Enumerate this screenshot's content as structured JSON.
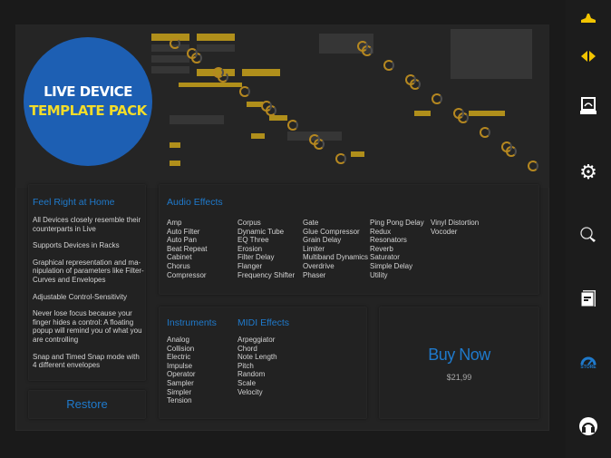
{
  "badge": {
    "line1": "LIVE DEVICE",
    "line2": "TEMPLATE PACK"
  },
  "features": {
    "title": "Feel Right at Home",
    "items": [
      "All Devices closely resemble their counterparts in Live",
      "Supports Devices in Racks",
      "Graphical representation and ma-nipulation of parameters like Filter-Curves and Envelopes",
      "Adjustable Control-Sensitivity",
      "Never lose focus because your finger hides a control: A floating popup will remind you of what you are controlling",
      "Snap and Timed Snap mode with 4 different envelopes"
    ]
  },
  "audio_effects": {
    "title": "Audio Effects",
    "columns": [
      [
        "Amp",
        "Auto Filter",
        "Auto Pan",
        "Beat Repeat",
        "Cabinet",
        "Chorus",
        "Compressor"
      ],
      [
        "Corpus",
        "Dynamic Tube",
        "EQ Three",
        "Erosion",
        "Filter Delay",
        "Flanger",
        "Frequency Shifter"
      ],
      [
        "Gate",
        "Glue Compressor",
        "Grain Delay",
        "Limiter",
        "Multiband Dynamics",
        "Overdrive",
        "Phaser"
      ],
      [
        "Ping Pong Delay",
        "Redux",
        "Resonators",
        "Reverb",
        "Saturator",
        "Simple Delay",
        "Utility"
      ],
      [
        "Vinyl Distortion",
        "Vocoder"
      ]
    ]
  },
  "instruments": {
    "title": "Instruments",
    "items": [
      "Analog",
      "Collision",
      "Electric",
      "Impulse",
      "Operator",
      "Sampler",
      "Simpler",
      "Tension"
    ]
  },
  "midi_effects": {
    "title": "MIDI Effects",
    "items": [
      "Arpeggiator",
      "Chord",
      "Note Length",
      "Pitch",
      "Random",
      "Scale",
      "Velocity"
    ]
  },
  "buy": {
    "label": "Buy Now",
    "price": "$21,99"
  },
  "restore": {
    "label": "Restore"
  },
  "sidebar": {
    "items": [
      "device-icon",
      "split-icon",
      "monitor-icon",
      "gear-icon",
      "midi-map-icon",
      "manual-icon",
      "store-icon",
      "support-icon"
    ],
    "store_label": "STORE"
  },
  "colors": {
    "accent": "#1f7acc",
    "yellow": "#f2c400",
    "badge": "#1d5fb3"
  }
}
